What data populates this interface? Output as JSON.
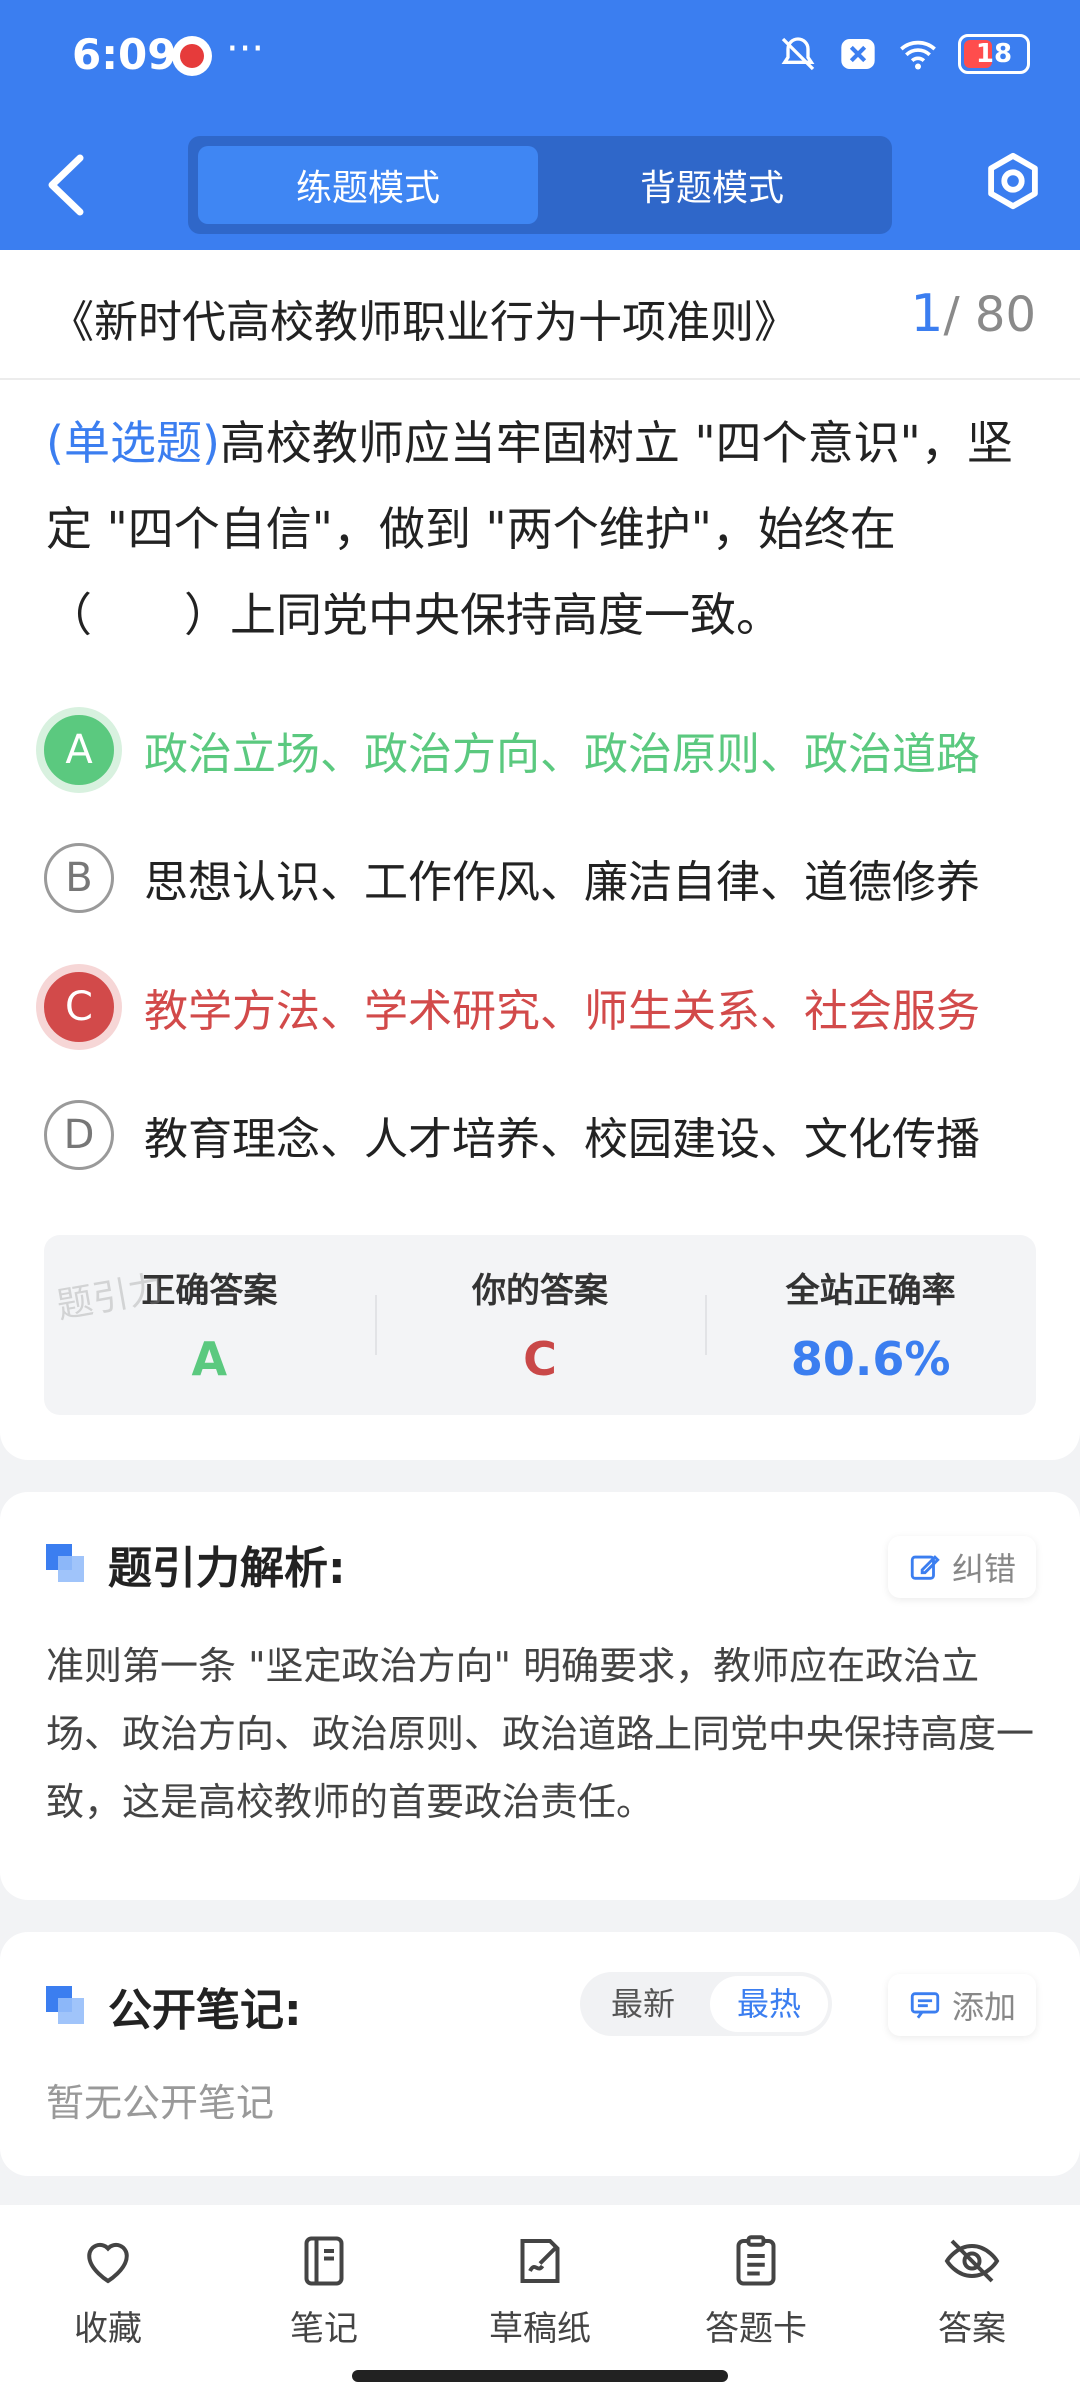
{
  "status_bar": {
    "time": "6:09",
    "dots": "···",
    "battery": "18"
  },
  "header": {
    "tabs": [
      {
        "label": "练题模式",
        "active": true
      },
      {
        "label": "背题模式",
        "active": false
      }
    ]
  },
  "titlebar": {
    "title": "《新时代高校教师职业行为十项准则》",
    "current": "1",
    "total": "/ 80"
  },
  "question": {
    "type_tag": "(单选题)",
    "text": "高校教师应当牢固树立 \"四个意识\"，坚定 \"四个自信\"，做到 \"两个维护\"，始终在（　　）上同党中央保持高度一致。",
    "options": [
      {
        "letter": "A",
        "text": "政治立场、政治方向、政治原则、政治道路",
        "state": "correct"
      },
      {
        "letter": "B",
        "text": "思想认识、工作作风、廉洁自律、道德修养",
        "state": "normal"
      },
      {
        "letter": "C",
        "text": "教学方法、学术研究、师生关系、社会服务",
        "state": "wrong"
      },
      {
        "letter": "D",
        "text": "教育理念、人才培养、校园建设、文化传播",
        "state": "normal"
      }
    ]
  },
  "stats": [
    {
      "label": "正确答案",
      "value": "A",
      "color": "#5bc97f"
    },
    {
      "label": "你的答案",
      "value": "C",
      "color": "#c94848"
    },
    {
      "label": "全站正确率",
      "value": "80.6%",
      "color": "#3b7ef0"
    }
  ],
  "watermark": "题引力",
  "analysis": {
    "heading": "题引力解析:",
    "correct_button": "纠错",
    "text": "准则第一条 \"坚定政治方向\" 明确要求，教师应在政治立场、政治方向、政治原则、政治道路上同党中央保持高度一致，这是高校教师的首要政治责任。"
  },
  "notes": {
    "heading": "公开笔记:",
    "sort_newest": "最新",
    "sort_hottest": "最热",
    "add_button": "添加",
    "empty_text": "暂无公开笔记"
  },
  "bottom_bar": [
    {
      "label": "收藏",
      "icon": "heart-icon"
    },
    {
      "label": "笔记",
      "icon": "notebook-icon"
    },
    {
      "label": "草稿纸",
      "icon": "draft-icon"
    },
    {
      "label": "答题卡",
      "icon": "answer-sheet-icon"
    },
    {
      "label": "答案",
      "icon": "eye-off-icon"
    }
  ]
}
